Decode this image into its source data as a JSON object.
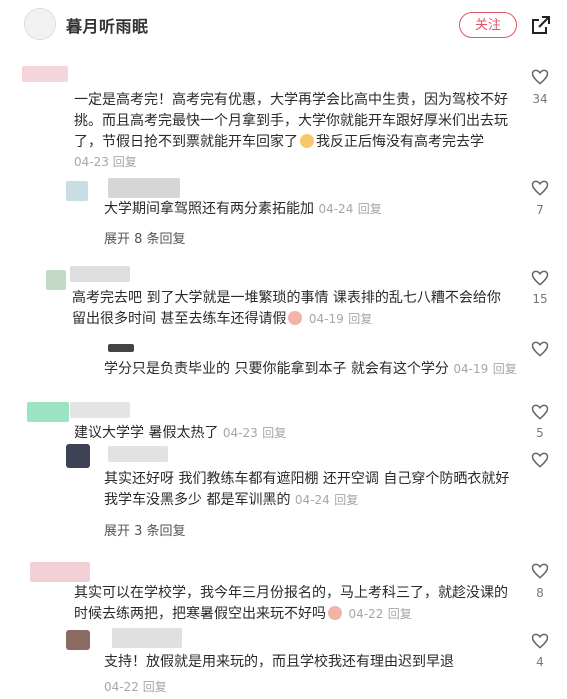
{
  "header": {
    "title": "暮月听雨眠",
    "follow_label": "关注"
  },
  "comments": [
    {
      "text_lines": [
        "一定是高考完！高考完有优惠，大学再学会比高中生贵，因为驾校不好",
        "挑。而且高考完最快一个月拿到手，大学你就能开车跟好厚米们出去玩",
        "了，节假日抢不到票就能开车回家了",
        "我反正后悔没有高考完去学"
      ],
      "date": "04-23",
      "reply": "回复",
      "likes": "34"
    },
    {
      "text": "大学期间拿驾照还有两分素拓能加",
      "date": "04-24",
      "reply": "回复",
      "likes": "7",
      "expand": "展开 8 条回复"
    },
    {
      "text_lines": [
        "高考完去吧 到了大学就是一堆繁琐的事情 课表排的乱七八糟不会给你",
        "留出很多时间 甚至去练车还得请假"
      ],
      "date": "04-19",
      "reply": "回复",
      "likes": "15"
    },
    {
      "text": "学分只是负责毕业的 只要你能拿到本子 就会有这个学分",
      "date": "04-19",
      "reply": "回复",
      "likes": ""
    },
    {
      "text": "建议大学学 暑假太热了",
      "date": "04-23",
      "reply": "回复",
      "likes": "5"
    },
    {
      "text_lines": [
        "其实还好呀 我们教练车都有遮阳棚 还开空调 自己穿个防晒衣就好",
        "我学车没黑多少 都是军训黑的"
      ],
      "date": "04-24",
      "reply": "回复",
      "likes": "",
      "expand": "展开 3 条回复"
    },
    {
      "text_lines": [
        "其实可以在学校学，我今年三月份报名的，马上考科三了，就趁没课的",
        "时候去练两把，把寒暑假空出来玩不好吗"
      ],
      "date": "04-22",
      "reply": "回复",
      "likes": "8"
    },
    {
      "text": "支持！放假就是用来玩的，而且学校我还有理由迟到早退",
      "date": "04-22",
      "reply": "回复",
      "likes": "4"
    }
  ],
  "colors": {
    "accent": "#e0566a",
    "meta": "#a6a6a6"
  },
  "icons": {
    "like": "heart-outline-icon",
    "share": "share-arrow-icon"
  }
}
